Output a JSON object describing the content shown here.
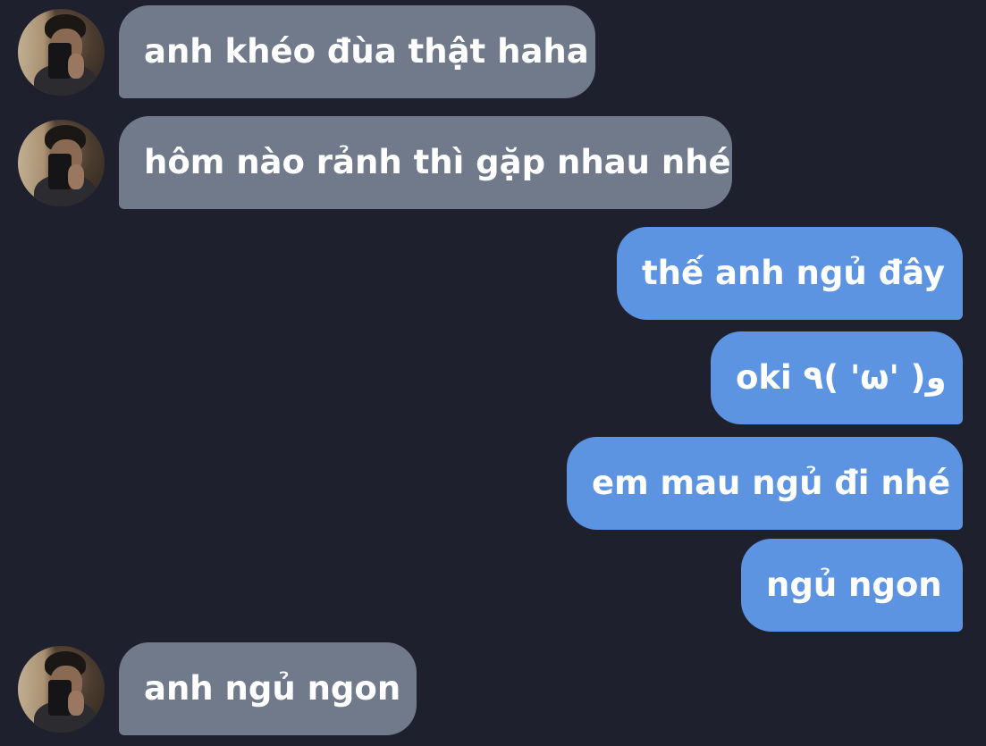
{
  "messages": [
    {
      "direction": "incoming",
      "text": "anh khéo đùa thật haha"
    },
    {
      "direction": "incoming",
      "text": "hôm nào rảnh thì gặp nhau nhé"
    },
    {
      "direction": "outgoing",
      "text": "thế anh ngủ đây"
    },
    {
      "direction": "outgoing",
      "text": "oki ٩( 'ω' )و"
    },
    {
      "direction": "outgoing",
      "text": "em mau ngủ đi nhé"
    },
    {
      "direction": "outgoing",
      "text": "ngủ ngon"
    },
    {
      "direction": "incoming",
      "text": "anh ngủ ngon"
    }
  ],
  "colors": {
    "background": "#1f202d",
    "incoming_bubble": "#717a8b",
    "outgoing_bubble": "#5d94e1",
    "text": "#ffffff"
  },
  "icons": {
    "avatar": "contact-avatar"
  }
}
